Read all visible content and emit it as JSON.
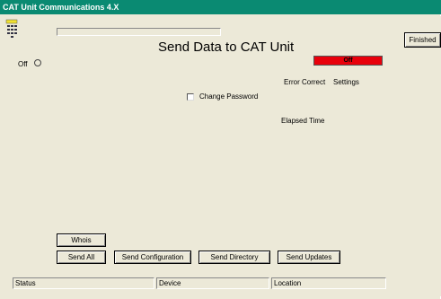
{
  "window": {
    "title": "CAT Unit Communications 4.X"
  },
  "header": {
    "page_title": "Send Data to CAT Unit",
    "off_label": "Off",
    "status_indicator": "Off",
    "finished_label": "Finished"
  },
  "info": {
    "error_correct": "Error Correct",
    "settings": "Settings",
    "change_password": "Change Password",
    "change_password_checked": false,
    "elapsed_time": "Elapsed Time"
  },
  "buttons": {
    "whois": "Whois",
    "send_all": "Send All",
    "send_configuration": "Send Configuration",
    "send_directory": "Send Directory",
    "send_updates": "Send Updates"
  },
  "statusbar": {
    "status": "Status",
    "device": "Device",
    "location": "Location"
  },
  "colors": {
    "titlebar": "#0a8a72",
    "window_bg": "#ece9d8",
    "status_indicator": "#e8000b"
  },
  "icons": {
    "app": "keypad-icon"
  }
}
